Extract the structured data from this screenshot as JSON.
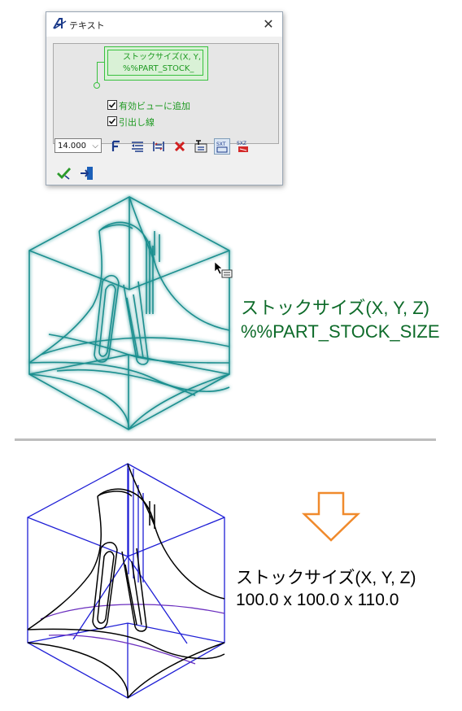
{
  "dialog": {
    "title": "テキスト",
    "close_label": "✕",
    "preview": {
      "line1": "ストックサイズ(X, Y,",
      "line2": "%%PART_STOCK_"
    },
    "options": [
      {
        "label": "有効ビューに追加",
        "checked": true
      },
      {
        "label": "引出し線",
        "checked": true
      }
    ],
    "font_size_value": "14.000"
  },
  "top_figure": {
    "stock_label_line1": "ストックサイズ(X, Y, Z)",
    "stock_label_line2": "%%PART_STOCK_SIZE"
  },
  "bottom_figure": {
    "stock_label_line1": "ストックサイズ(X, Y, Z)",
    "stock_label_line2": "100.0 x 100.0 x 110.0"
  },
  "colors": {
    "accent_green": "#1e9a22",
    "teal_model": "#1a8f8f",
    "label_green": "#0e6b2a",
    "blue_frame": "#1f1fd6",
    "arrow_orange": "#f08a2c"
  }
}
